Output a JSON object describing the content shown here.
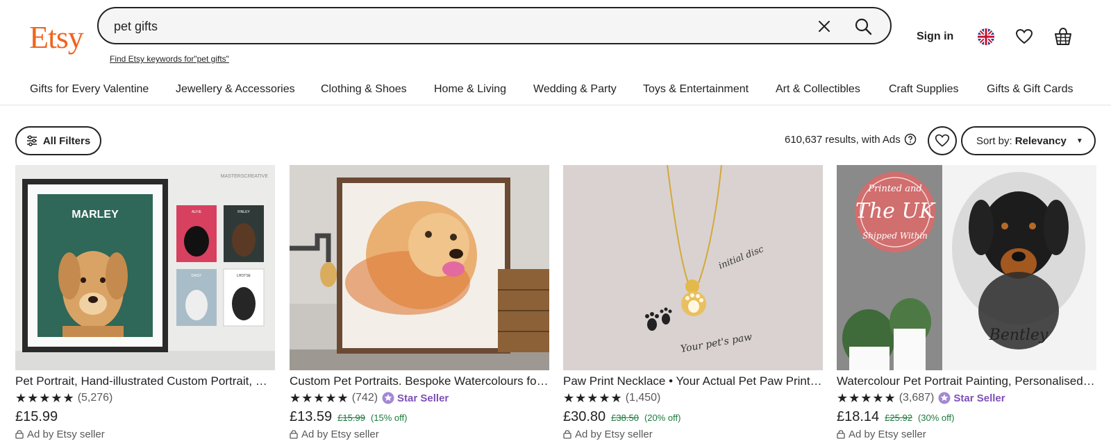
{
  "header": {
    "logo": "Etsy",
    "search_value": "pet gifts",
    "find_keywords": "Find Etsy keywords for\"pet gifts\"",
    "sign_in": "Sign in"
  },
  "nav": {
    "items": [
      "Gifts for Every Valentine",
      "Jewellery & Accessories",
      "Clothing & Shoes",
      "Home & Living",
      "Wedding & Party",
      "Toys & Entertainment",
      "Art & Collectibles",
      "Craft Supplies",
      "Gifts & Gift Cards"
    ]
  },
  "toolbar": {
    "filters_label": "All Filters",
    "results_text": "610,637 results, with Ads",
    "sort_prefix": "Sort by:",
    "sort_value": "Relevancy"
  },
  "listings": [
    {
      "title": "Pet Portrait, Hand-illustrated Custom Portrait, Pet Illustration, Personalised Gift",
      "rating": 5,
      "reviews": "(5,276)",
      "star_seller": "",
      "price": "£15.99",
      "original_price": "",
      "discount": "",
      "ad": "Ad by Etsy seller",
      "image_text": "MARLEY",
      "image_labels": [
        "MASTERSCREATIVE",
        "ALFIE",
        "FINLEY",
        "DAISY",
        "LHOTSE"
      ]
    },
    {
      "title": "Custom Pet Portraits. Bespoke Watercolours for Pet Lovers",
      "rating": 5,
      "reviews": "(742)",
      "star_seller": "Star Seller",
      "price": "£13.59",
      "original_price": "£15.99",
      "discount": "(15% off)",
      "ad": "Ad by Etsy seller"
    },
    {
      "title": "Paw Print Necklace • Your Actual Pet Paw Print Necklace",
      "rating": 5,
      "reviews": "(1,450)",
      "star_seller": "",
      "price": "£30.80",
      "original_price": "£38.50",
      "discount": "(20% off)",
      "ad": "Ad by Etsy seller",
      "image_text_1": "initial disc",
      "image_text_2": "Your pet's paw"
    },
    {
      "title": "Watercolour Pet Portrait Painting, Personalised Gift",
      "rating": 5,
      "reviews": "(3,687)",
      "star_seller": "Star Seller",
      "price": "£18.14",
      "original_price": "£25.92",
      "discount": "(30% off)",
      "ad": "Ad by Etsy seller",
      "image_stamp_1": "Printed and",
      "image_stamp_2": "The UK",
      "image_stamp_3": "Shipped Within",
      "image_name": "Bentley"
    }
  ],
  "colors": {
    "brand": "#f1641e",
    "star_seller": "#7d4fb7",
    "discount": "#1c7a3e"
  }
}
